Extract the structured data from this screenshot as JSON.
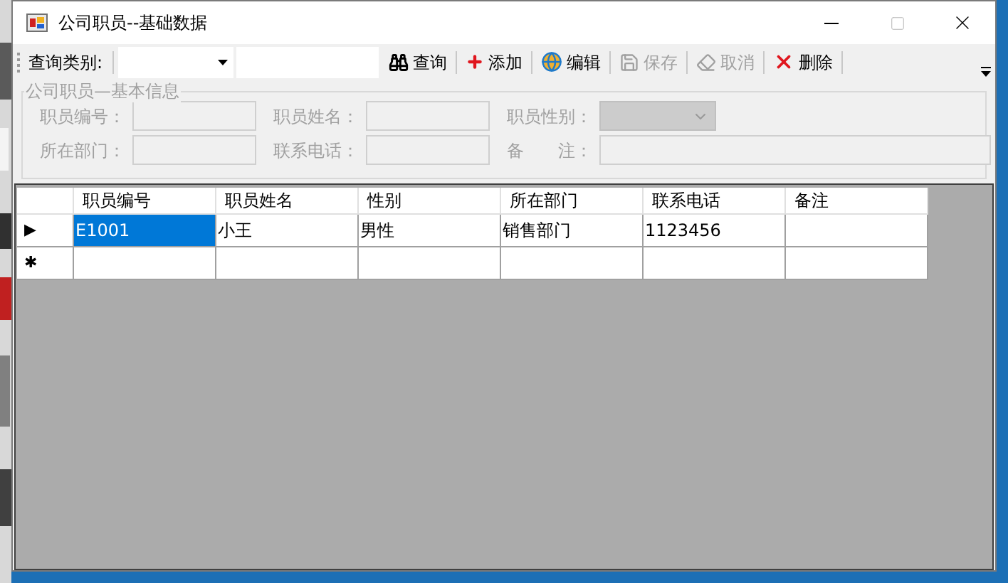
{
  "window": {
    "title": "公司职员--基础数据"
  },
  "toolbar": {
    "items": [
      {
        "kind": "label",
        "text": "查询类别:"
      },
      {
        "kind": "combo"
      },
      {
        "kind": "field"
      },
      {
        "kind": "button",
        "text": "查询",
        "disabled": false
      },
      {
        "kind": "button",
        "text": "添加",
        "disabled": false
      },
      {
        "kind": "button",
        "text": "编辑",
        "disabled": false
      },
      {
        "kind": "button",
        "text": "保存",
        "disabled": true
      },
      {
        "kind": "button",
        "text": "取消",
        "disabled": true
      },
      {
        "kind": "button",
        "text": "删除",
        "disabled": false
      }
    ]
  },
  "info_group": {
    "title": "公司职员—基本信息",
    "disabled": true,
    "fields": [
      {
        "label": "职员编号：",
        "kind": "text"
      },
      {
        "label": "职员姓名：",
        "kind": "text"
      },
      {
        "label": "职员性别：",
        "kind": "combo"
      },
      {
        "label": "所在部门：",
        "kind": "text"
      },
      {
        "label": "联系电话：",
        "kind": "text"
      },
      {
        "label": "备　　注：",
        "kind": "wide"
      }
    ]
  },
  "grid": {
    "columns": [
      "职员编号",
      "职员姓名",
      "性别",
      "所在部门",
      "联系电话",
      "备注"
    ],
    "rows": [
      {
        "indicator": "▶",
        "cells": [
          {
            "text": "E1001",
            "selected": true
          },
          {
            "text": "小王",
            "selected": false
          },
          {
            "text": "男性",
            "selected": false
          },
          {
            "text": "销售部门",
            "selected": false
          },
          {
            "text": "1123456",
            "selected": false
          }
        ]
      },
      {
        "indicator": "✱",
        "cells": []
      }
    ]
  }
}
